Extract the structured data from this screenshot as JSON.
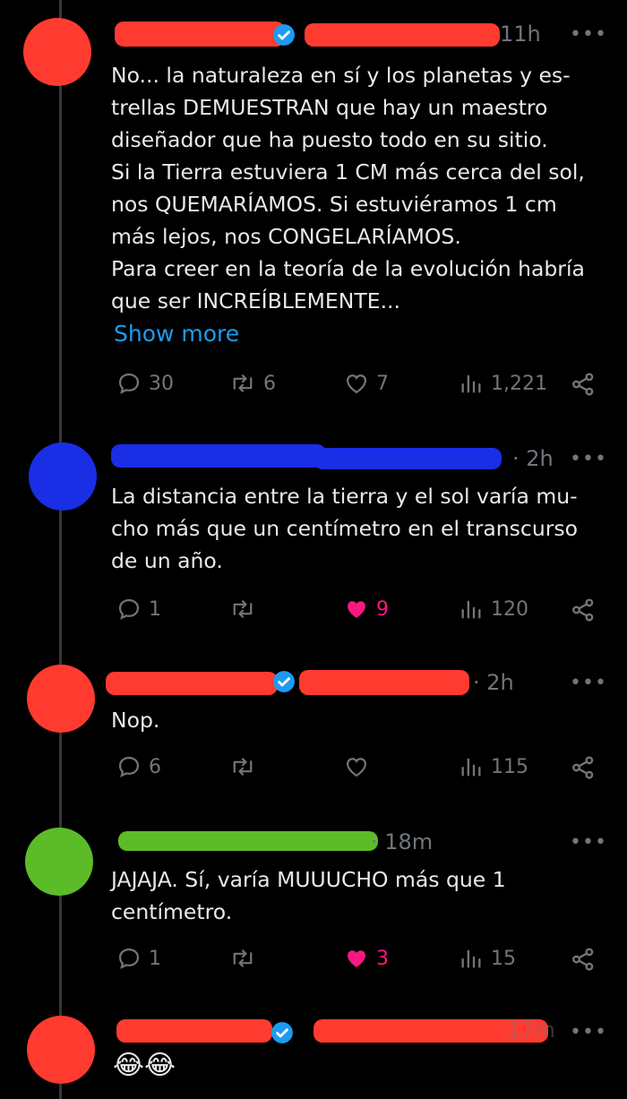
{
  "colors": {
    "bg": "#000000",
    "text": "#e7e9ea",
    "muted": "#71767b",
    "link": "#1d9bf0",
    "like": "#f91880",
    "verified": "#1d9bf0"
  },
  "tweets": [
    {
      "time": "11h",
      "body": "No... la naturaleza en sí y los planetas y es-\ntrellas DEMUESTRAN que hay un maestro\ndiseñador que ha puesto todo en su sitio.\nSi la Tierra estuviera  1 CM más cerca del sol,\nnos QUEMARÍAMOS. Si estuviéramos 1 cm\nmás lejos, nos CONGELARÍAMOS.\nPara creer en la teoría de la evolución habría\nque ser INCREÍBLEMENTE...",
      "show_more": "Show more",
      "replies": "30",
      "reposts": "6",
      "likes": "7",
      "views": "1,221",
      "liked": false
    },
    {
      "time": "· 2h",
      "body": "La distancia entre la tierra y el sol varía mu-\ncho más que un centímetro en el transcurso\nde un año.",
      "replies": "1",
      "reposts": "",
      "likes": "9",
      "views": "120",
      "liked": true
    },
    {
      "time": "· 2h",
      "body": "Nop.",
      "replies": "6",
      "reposts": "",
      "likes": "",
      "views": "115",
      "liked": false
    },
    {
      "time": "· 18m",
      "body": "JAJAJA. Sí, varía MUUUCHO más que 1\ncentímetro.",
      "replies": "1",
      "reposts": "",
      "likes": "3",
      "views": "15",
      "liked": true
    },
    {
      "time": "17m",
      "body": "😂😂"
    }
  ],
  "icons": {
    "reply": "reply-icon",
    "repost": "repost-icon",
    "like": "heart-icon",
    "views": "views-icon",
    "share": "share-icon",
    "more": "more-dots-icon",
    "verified": "verified-badge-icon"
  }
}
